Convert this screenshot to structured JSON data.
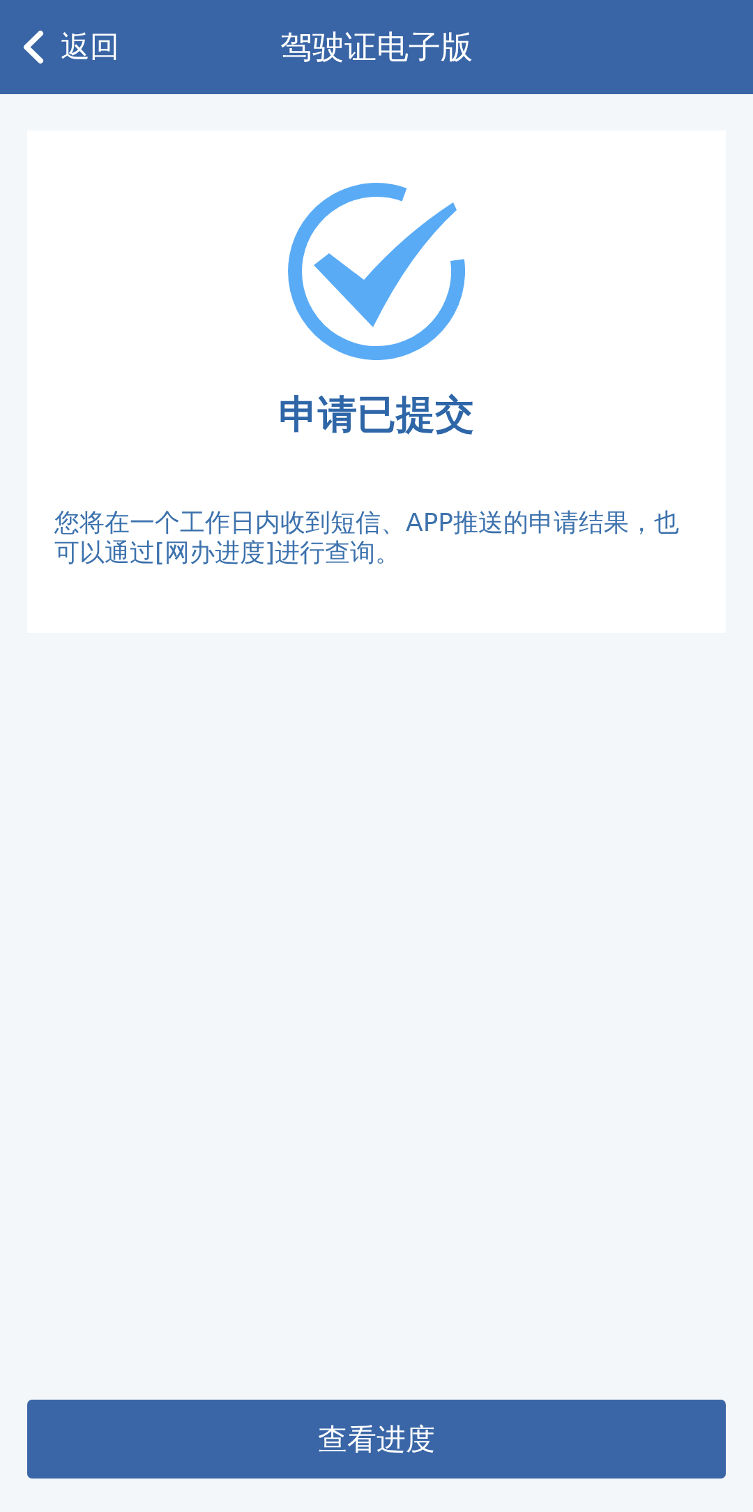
{
  "header": {
    "back_label": "返回",
    "title": "驾驶证电子版"
  },
  "result": {
    "title": "申请已提交",
    "message": "您将在一个工作日内收到短信、APP推送的申请结果，也可以通过[网办进度]进行查询。"
  },
  "button": {
    "label": "查看进度"
  }
}
